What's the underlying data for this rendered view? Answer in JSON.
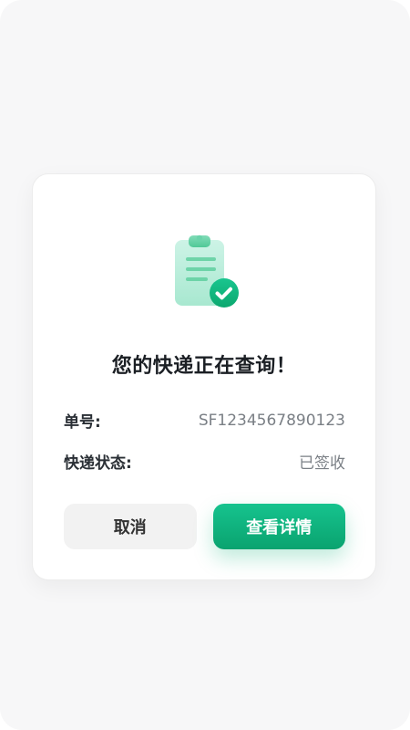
{
  "dialog": {
    "title": "您的快递正在查询！",
    "details": {
      "tracking_label": "单号:",
      "tracking_value": "SF1234567890123",
      "status_label": "快递状态:",
      "status_value": "已签收"
    },
    "actions": {
      "cancel_label": "取消",
      "view_details_label": "查看详情"
    }
  },
  "icons": {
    "hero_icon": "clipboard-check-icon"
  },
  "colors": {
    "accent_green": "#10B981",
    "accent_green_dark": "#0EA06F",
    "button_gray": "#F2F2F2",
    "text_dark": "#1B1F24",
    "text_muted": "#7A7F85"
  }
}
